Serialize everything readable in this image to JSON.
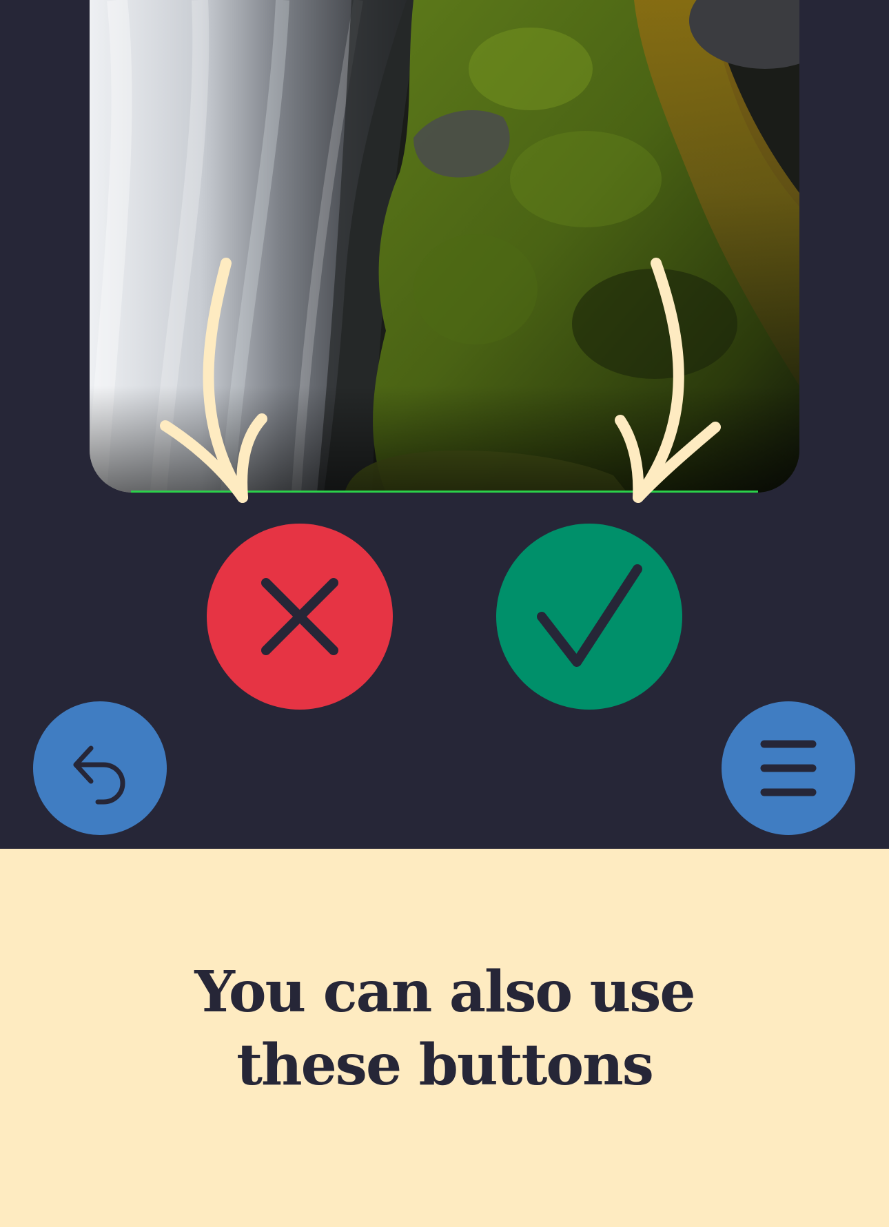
{
  "photo": {
    "subject": "waterfall-and-mossy-rock"
  },
  "controls": {
    "reject": {
      "icon": "close-icon",
      "color": "#E63444"
    },
    "accept": {
      "icon": "check-icon",
      "color": "#00906A"
    },
    "undo": {
      "icon": "undo-icon",
      "color": "#407DC2"
    },
    "menu": {
      "icon": "hamburger-menu-icon",
      "color": "#407DC2"
    },
    "icon_color": "#262637",
    "arrow_color": "#FEEBC1"
  },
  "tutorial": {
    "hint_text": "You can also use these buttons"
  },
  "colors": {
    "dark_background": "#262637",
    "light_background": "#FEEBC1"
  }
}
